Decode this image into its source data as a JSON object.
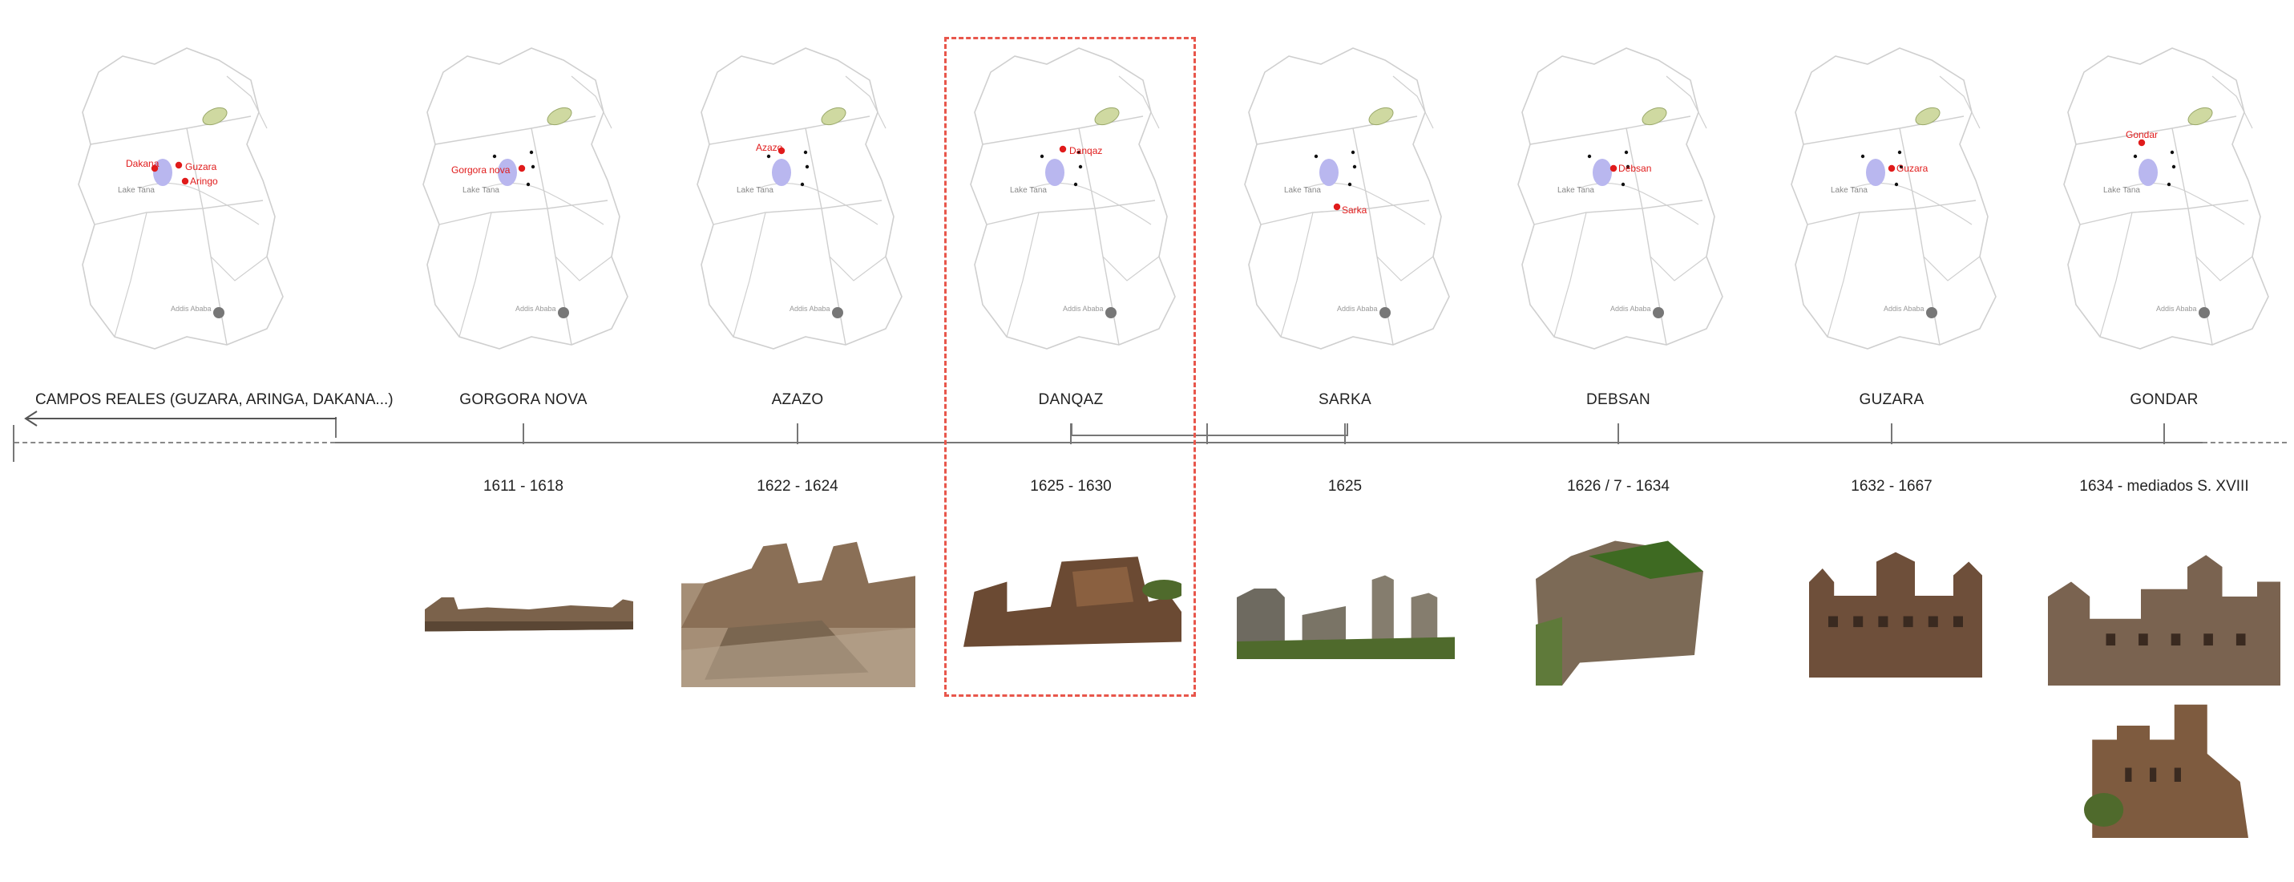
{
  "sites": [
    {
      "id": "campos",
      "label": "CAMPOS REALES (GUZARA, ARINGA, DAKANA...)",
      "date": "",
      "red": [
        "Dakana",
        "Guzara",
        "Aringo"
      ]
    },
    {
      "id": "gorgora",
      "label": "GORGORA NOVA",
      "date": "1611 - 1618",
      "red": [
        "Gorgora nova"
      ]
    },
    {
      "id": "azazo",
      "label": "AZAZO",
      "date": "1622 - 1624",
      "red": [
        "Azazo"
      ]
    },
    {
      "id": "danqaz",
      "label": "DANQAZ",
      "date": "1625 - 1630",
      "red": [
        "Danqaz"
      ]
    },
    {
      "id": "sarka",
      "label": "SARKA",
      "date": "1625",
      "red": [
        "Sarka"
      ]
    },
    {
      "id": "debsan",
      "label": "DEBSAN",
      "date": "1626 / 7 - 1634",
      "red": [
        "Debsan"
      ]
    },
    {
      "id": "guzara",
      "label": "GUZARA",
      "date": "1632 - 1667",
      "red": [
        "Guzara"
      ]
    },
    {
      "id": "gondar",
      "label": "GONDAR",
      "date": "1634 - mediados S. XVIII",
      "red": [
        "Gondar"
      ]
    }
  ],
  "map_labels": {
    "lake": "Lake Tana",
    "city": "Addis Ababa"
  },
  "colors": {
    "red": "#e01b1b",
    "lake": "#b9b7ef",
    "park": "#cfd9a1",
    "grid": "#cfcfcf",
    "line": "#777777",
    "highlight": "#e8564b"
  }
}
